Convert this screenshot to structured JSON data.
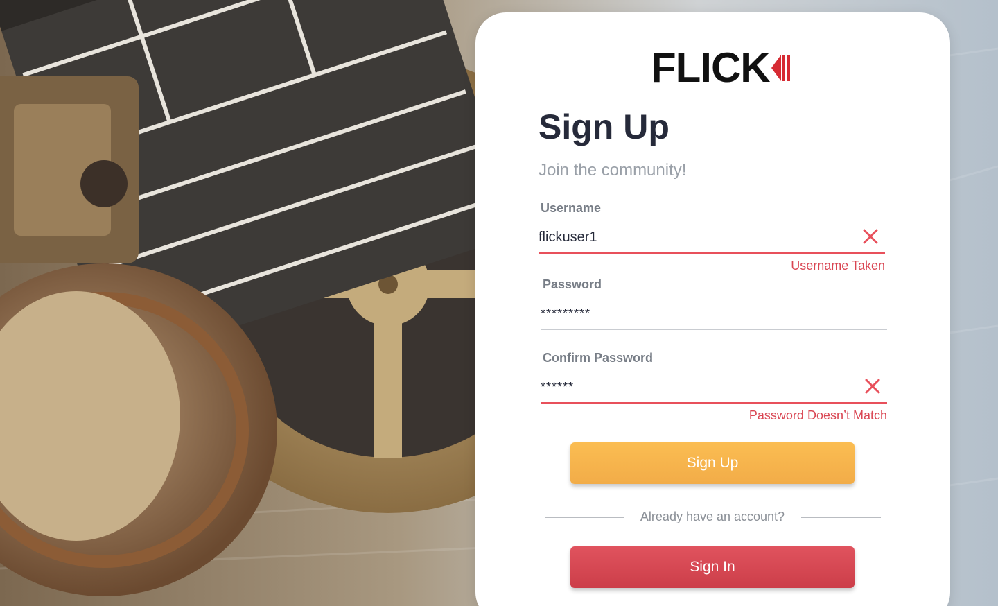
{
  "brand": {
    "logo_text": "FLICK",
    "accent": "#d62b33"
  },
  "form": {
    "title": "Sign Up",
    "subtitle": "Join the community!",
    "username": {
      "label": "Username",
      "value": "flickuser1",
      "error": "Username Taken",
      "status": "error"
    },
    "password": {
      "label": "Password",
      "value": "*********",
      "status": "normal"
    },
    "confirm_password": {
      "label": "Confirm Password",
      "value": "******",
      "error": "Password Doesn’t Match",
      "status": "error"
    },
    "signup_button": "Sign Up",
    "divider_text": "Already have an account?",
    "signin_button": "Sign In"
  },
  "colors": {
    "error": "#e8505b",
    "signup_button": "#f5b34b",
    "signin_button": "#d64651",
    "title": "#262a3a"
  },
  "icons": {
    "clear": "close-x-icon",
    "background": "film-clapperboard-and-reels-photo"
  }
}
